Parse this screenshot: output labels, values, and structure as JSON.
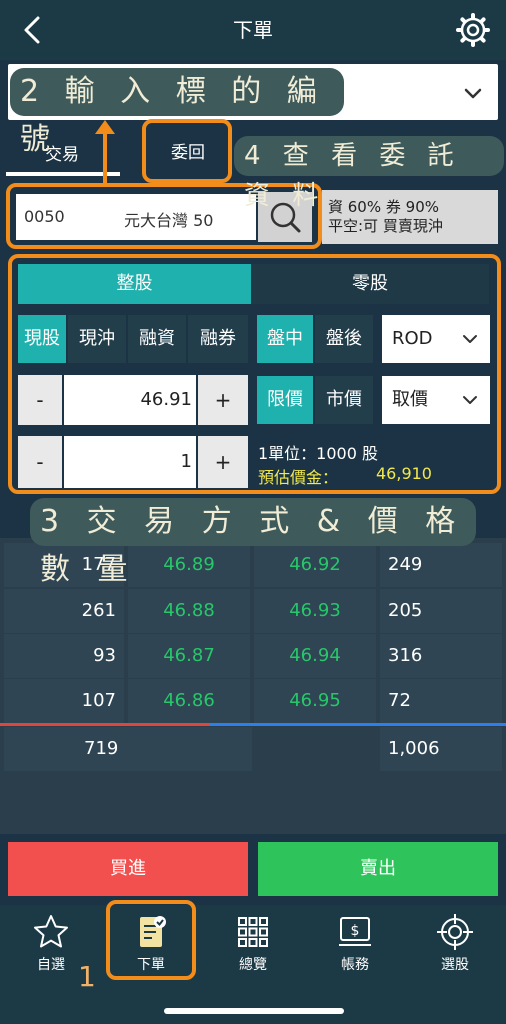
{
  "header": {
    "title": "下單",
    "back_icon": "chevron-left-icon",
    "settings_icon": "gear-icon"
  },
  "symbol_select": {
    "chevron_icon": "chevron-down-icon"
  },
  "tabs": {
    "trade": "交易",
    "orders": "委回"
  },
  "search": {
    "code": "0050",
    "name": "元大台灣 50",
    "icon": "search-icon"
  },
  "margin_info": {
    "line1": "資 60% 券 90%",
    "line2": "平空:可 買賣現沖"
  },
  "lot_type": {
    "whole": "整股",
    "odd": "零股",
    "selected": "整股"
  },
  "trade_type": {
    "cash": "現股",
    "day_trade": "現沖",
    "margin": "融資",
    "short": "融券",
    "selected": "現股"
  },
  "session": {
    "day": "盤中",
    "after": "盤後",
    "selected": "盤中"
  },
  "time_in_force": {
    "value": "ROD"
  },
  "price_type": {
    "limit": "限價",
    "market": "市價",
    "selected": "限價"
  },
  "price_select": {
    "value": "取價"
  },
  "price": {
    "minus": "-",
    "value": "46.91",
    "plus": "+"
  },
  "quantity": {
    "minus": "-",
    "value": "1",
    "plus": "+"
  },
  "unit_info": "1單位：1000 股",
  "estimate": {
    "label": "預估價金：",
    "value": "46,910"
  },
  "order_book": {
    "rows": [
      {
        "bid_vol": "177",
        "bid": "46.89",
        "ask": "46.92",
        "ask_vol": "249"
      },
      {
        "bid_vol": "261",
        "bid": "46.88",
        "ask": "46.93",
        "ask_vol": "205"
      },
      {
        "bid_vol": "93",
        "bid": "46.87",
        "ask": "46.94",
        "ask_vol": "316"
      },
      {
        "bid_vol": "107",
        "bid": "46.86",
        "ask": "46.95",
        "ask_vol": "72"
      }
    ],
    "total_bid": "719",
    "total_ask": "1,006"
  },
  "actions": {
    "buy": "買進",
    "sell": "賣出"
  },
  "nav": [
    {
      "label": "自選",
      "icon": "star-icon"
    },
    {
      "label": "下單",
      "icon": "order-form-icon"
    },
    {
      "label": "總覽",
      "icon": "grid-icon"
    },
    {
      "label": "帳務",
      "icon": "account-icon"
    },
    {
      "label": "選股",
      "icon": "target-icon"
    }
  ],
  "annotations": {
    "step1": "1",
    "step2": "2 輸 入 標 的 編 號",
    "step3": "3 交 易 方 式 & 價 格 數 量",
    "step4": "4 查 看 委 託 資 料"
  },
  "colors": {
    "background": "#1b3344",
    "teal_active": "#1eb1ad",
    "buy_red": "#f2504e",
    "sell_green": "#2ec45b",
    "price_green": "#27c76a",
    "estimate_yellow": "#f3e94a",
    "annotation_orange": "#f28c1a"
  }
}
